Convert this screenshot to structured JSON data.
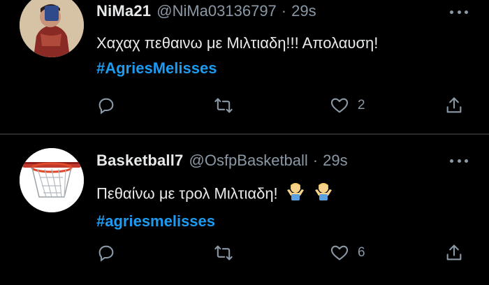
{
  "tweets": [
    {
      "name": "NiMa21",
      "handle": "@NiMa03136797",
      "separator": "·",
      "time": "29s",
      "text": "Χαχαχ πεθαινω με Μιλτιαδη!!! Απολαυση!",
      "hashtag": "#AgriesMelisses",
      "like_count": "2",
      "avatar_icon": "man-holding-object-avatar"
    },
    {
      "name": "Basketball7",
      "handle": "@OsfpBasketball",
      "separator": "·",
      "time": "29s",
      "text": "Πεθαίνω με τρολ Μιλτιαδη!",
      "hashtag": "#agriesmelisses",
      "like_count": "6",
      "avatar_icon": "basketball-hoop-avatar",
      "emojis": [
        "person-shrugging-emoji",
        "person-shrugging-emoji"
      ]
    }
  ],
  "icons": [
    "reply-icon",
    "retweet-icon",
    "like-icon",
    "share-icon",
    "more-icon"
  ],
  "colors": {
    "background": "#000000",
    "text": "#e7e9ea",
    "secondary": "#8b98a5",
    "hashtag": "#1d9bf0"
  }
}
